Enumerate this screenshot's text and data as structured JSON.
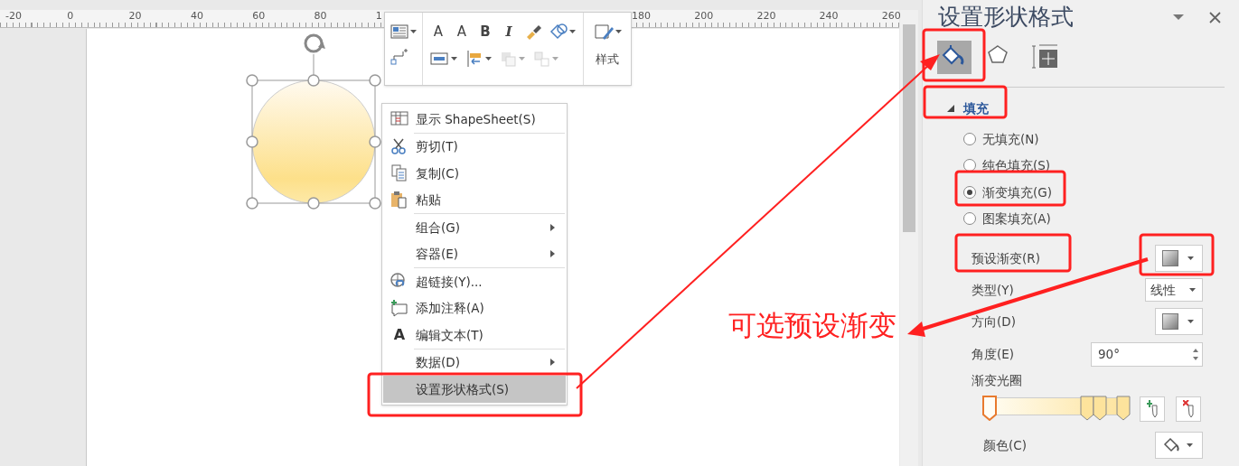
{
  "ruler": {
    "left_labels": [
      "-20",
      "0",
      "20",
      "40",
      "60",
      "80",
      "1"
    ],
    "right_labels": [
      "180",
      "200",
      "220",
      "240",
      "260"
    ]
  },
  "mini_toolbar": {
    "glyph_buttons": [
      {
        "text": "A"
      },
      {
        "text": "A"
      },
      {
        "text": "B"
      },
      {
        "text": "I"
      }
    ],
    "style_label": "样式"
  },
  "context_menu": {
    "items": [
      {
        "label": "显示 ShapeSheet(S)",
        "submenu": false,
        "selected": false,
        "separator_before": false
      },
      {
        "label": "剪切(T)",
        "submenu": false,
        "selected": false,
        "separator_before": true
      },
      {
        "label": "复制(C)",
        "submenu": false,
        "selected": false,
        "separator_before": false
      },
      {
        "label": "粘贴",
        "submenu": false,
        "selected": false,
        "separator_before": false
      },
      {
        "label": "组合(G)",
        "submenu": true,
        "selected": false,
        "separator_before": true
      },
      {
        "label": "容器(E)",
        "submenu": true,
        "selected": false,
        "separator_before": false
      },
      {
        "label": "超链接(Y)...",
        "submenu": false,
        "selected": false,
        "separator_before": true
      },
      {
        "label": "添加注释(A)",
        "submenu": false,
        "selected": false,
        "separator_before": false
      },
      {
        "label": "编辑文本(T)",
        "glyph": "A",
        "submenu": false,
        "selected": false,
        "separator_before": false
      },
      {
        "label": "数据(D)",
        "submenu": true,
        "selected": false,
        "separator_before": true
      },
      {
        "label": "设置形状格式(S)",
        "submenu": false,
        "selected": true,
        "separator_before": false
      }
    ]
  },
  "format_pane": {
    "title": "设置形状格式",
    "tabs": [
      {
        "selected": true
      },
      {
        "selected": false
      },
      {
        "selected": false
      }
    ],
    "section": {
      "label": "填充",
      "expanded": true
    },
    "fill_options": [
      {
        "label": "无填充(N)",
        "selected": false
      },
      {
        "label": "纯色填充(S)",
        "selected": false
      },
      {
        "label": "渐变填充(G)",
        "selected": true
      },
      {
        "label": "图案填充(A)",
        "selected": false
      }
    ],
    "preset_label": "预设渐变(R)",
    "type_label": "类型(Y)",
    "type_value": "线性",
    "direction_label": "方向(D)",
    "angle_label": "角度(E)",
    "angle_value": "90°",
    "stops_label": "渐变光圈",
    "gradient_stops": [
      {
        "selected": true
      },
      {
        "selected": false
      },
      {
        "selected": false
      },
      {
        "selected": false
      }
    ],
    "color_label": "颜色(C)"
  },
  "annotation": {
    "text": "可选预设渐变"
  }
}
